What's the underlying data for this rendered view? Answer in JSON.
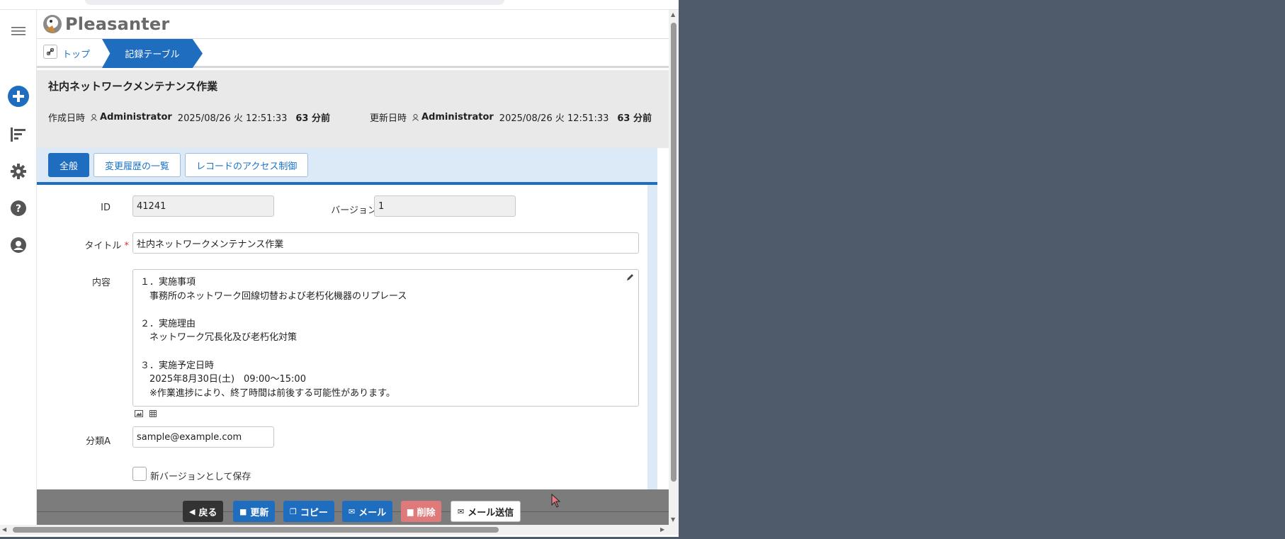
{
  "app": {
    "logo_text": "Pleasanter"
  },
  "breadcrumb": {
    "home": "トップ",
    "current": "記録テーブル"
  },
  "record": {
    "title": "社内ネットワークメンテナンス作業",
    "created": {
      "label": "作成日時",
      "user": "Administrator",
      "datetime": "2025/08/26 火 12:51:33",
      "ago": "63 分前"
    },
    "updated": {
      "label": "更新日時",
      "user": "Administrator",
      "datetime": "2025/08/26 火 12:51:33",
      "ago": "63 分前"
    }
  },
  "tabs": [
    {
      "label": "全般",
      "active": true
    },
    {
      "label": "変更履歴の一覧",
      "active": false
    },
    {
      "label": "レコードのアクセス制御",
      "active": false
    }
  ],
  "form": {
    "id_label": "ID",
    "id_value": "41241",
    "version_label": "バージョン",
    "version_value": "1",
    "title_label": "タイトル",
    "title_required": "*",
    "title_value": "社内ネットワークメンテナンス作業",
    "content_label": "内容",
    "content_value": "１．実施事項\n　事務所のネットワーク回線切替および老朽化機器のリプレース\n\n２．実施理由\n　ネットワーク冗長化及び老朽化対策\n\n３．実施予定日時\n　2025年8月30日(土)　09:00～15:00\n　※作業進捗により、終了時間は前後する可能性があります。",
    "classA_label": "分類A",
    "classA_value": "sample@example.com",
    "new_version_label": "新バージョンとして保存"
  },
  "buttons": {
    "back": "戻る",
    "update": "更新",
    "copy": "コピー",
    "mail": "メール",
    "delete": "削除",
    "send_mail": "メール送信"
  },
  "colors": {
    "primary": "#1f6dbf",
    "delete": "#e07a7a",
    "background": "#4f5b6b"
  }
}
